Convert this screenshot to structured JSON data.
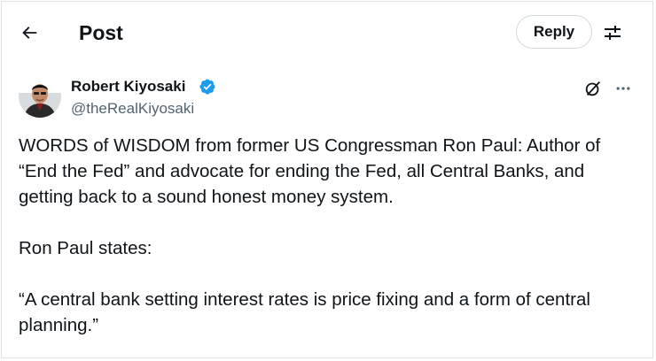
{
  "header": {
    "title": "Post",
    "reply_label": "Reply",
    "back_icon": "arrow-left-icon",
    "adjust_icon": "sliders-icon"
  },
  "author": {
    "name": "Robert Kiyosaki",
    "handle": "@theRealKiyosaki",
    "verified": true,
    "verified_color": "#1d9bf0"
  },
  "post": {
    "paragraphs": [
      "WORDS of WISDOM from former US Congressman Ron Paul:  Author of “End the Fed” and advocate for ending the Fed, all Central Banks, and getting back to a sound honest money system.",
      "Ron Paul states:",
      "“A central bank setting interest rates is price fixing and a form of central planning.”"
    ]
  },
  "colors": {
    "text": "#0f1419",
    "secondary_text": "#536471",
    "border": "#cfd9de",
    "accent": "#1d9bf0"
  }
}
